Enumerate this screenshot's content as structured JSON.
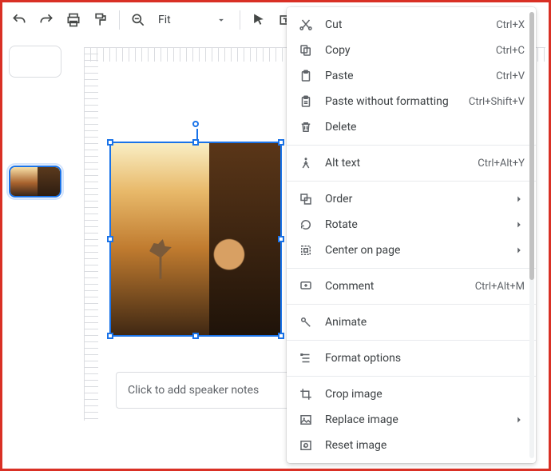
{
  "toolbar": {
    "zoom_label": "Fit"
  },
  "notes": {
    "placeholder": "Click to add speaker notes"
  },
  "context_menu": {
    "groups": [
      {
        "items": [
          {
            "icon": "cut-icon",
            "label": "Cut",
            "shortcut": "Ctrl+X"
          },
          {
            "icon": "copy-icon",
            "label": "Copy",
            "shortcut": "Ctrl+C"
          },
          {
            "icon": "paste-icon",
            "label": "Paste",
            "shortcut": "Ctrl+V"
          },
          {
            "icon": "paste-plain-icon",
            "label": "Paste without formatting",
            "shortcut": "Ctrl+Shift+V"
          },
          {
            "icon": "delete-icon",
            "label": "Delete"
          }
        ]
      },
      {
        "items": [
          {
            "icon": "alt-text-icon",
            "label": "Alt text",
            "shortcut": "Ctrl+Alt+Y"
          }
        ]
      },
      {
        "items": [
          {
            "icon": "order-icon",
            "label": "Order",
            "submenu": true
          },
          {
            "icon": "rotate-icon",
            "label": "Rotate",
            "submenu": true
          },
          {
            "icon": "center-icon",
            "label": "Center on page",
            "submenu": true
          }
        ]
      },
      {
        "items": [
          {
            "icon": "comment-icon",
            "label": "Comment",
            "shortcut": "Ctrl+Alt+M"
          }
        ]
      },
      {
        "items": [
          {
            "icon": "animate-icon",
            "label": "Animate"
          }
        ]
      },
      {
        "items": [
          {
            "icon": "format-options-icon",
            "label": "Format options"
          }
        ]
      },
      {
        "items": [
          {
            "icon": "crop-icon",
            "label": "Crop image"
          },
          {
            "icon": "replace-image-icon",
            "label": "Replace image",
            "submenu": true
          },
          {
            "icon": "reset-image-icon",
            "label": "Reset image"
          }
        ]
      }
    ]
  }
}
